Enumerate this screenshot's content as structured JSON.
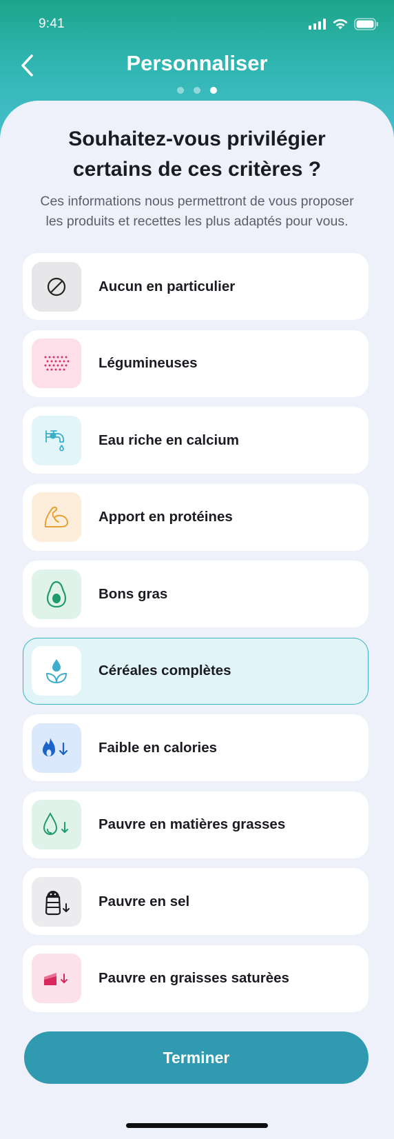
{
  "status_bar": {
    "time": "9:41"
  },
  "header": {
    "title": "Personnaliser",
    "step_total": 3,
    "step_current": 3
  },
  "intro": {
    "question_line1": "Souhaitez-vous privilégier",
    "question_line2": "certains de ces critères ?",
    "subtitle_line1": "Ces informations nous permettront de vous proposer",
    "subtitle_line2": "les produits et recettes les plus adaptés pour vous."
  },
  "options": [
    {
      "label": "Aucun en particulier",
      "icon": "none-icon",
      "selected": false
    },
    {
      "label": "Légumineuses",
      "icon": "legumes-icon",
      "selected": false
    },
    {
      "label": "Eau riche en calcium",
      "icon": "water-tap-icon",
      "selected": false
    },
    {
      "label": "Apport en protéines",
      "icon": "muscle-icon",
      "selected": false
    },
    {
      "label": "Bons gras",
      "icon": "avocado-icon",
      "selected": false
    },
    {
      "label": "Céréales complètes",
      "icon": "grain-icon",
      "selected": true
    },
    {
      "label": "Faible en calories",
      "icon": "flame-down-icon",
      "selected": false
    },
    {
      "label": "Pauvre en matières grasses",
      "icon": "fat-drop-down-icon",
      "selected": false
    },
    {
      "label": "Pauvre en sel",
      "icon": "salt-shaker-down-icon",
      "selected": false
    },
    {
      "label": "Pauvre en graisses saturèes",
      "icon": "cake-down-icon",
      "selected": false
    }
  ],
  "finish_button": {
    "label": "Terminer"
  },
  "colors": {
    "header_start": "#1da58b",
    "header_end": "#46bfcc",
    "button": "#2f9ab0",
    "selected_border": "#33b3c5",
    "selected_bg": "#e1f4f8"
  }
}
